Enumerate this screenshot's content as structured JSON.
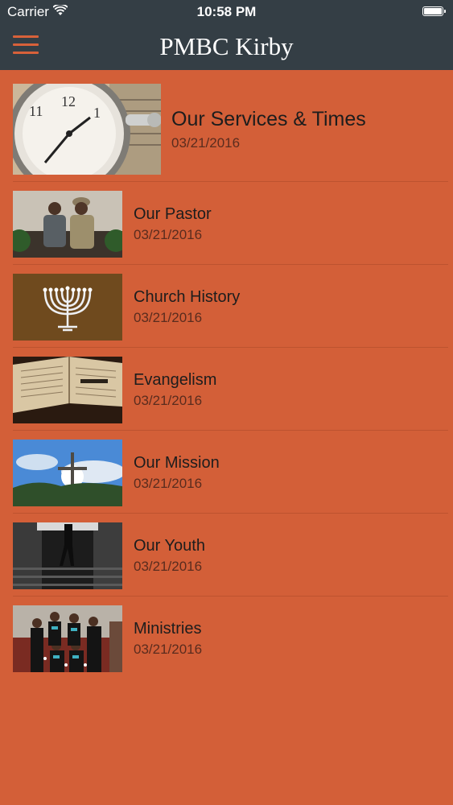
{
  "status_bar": {
    "carrier": "Carrier",
    "time": "10:58 PM"
  },
  "header": {
    "title": "PMBC Kirby",
    "menu_icon": "hamburger-icon"
  },
  "items": [
    {
      "title": "Our Services & Times",
      "date": "03/21/2016",
      "image": "pocket-watch-photo"
    },
    {
      "title": "Our Pastor",
      "date": "03/21/2016",
      "image": "pastor-couple-photo"
    },
    {
      "title": "Church History",
      "date": "03/21/2016",
      "image": "menorah-photo"
    },
    {
      "title": "Evangelism",
      "date": "03/21/2016",
      "image": "open-bible-photo"
    },
    {
      "title": "Our Mission",
      "date": "03/21/2016",
      "image": "cross-sky-photo"
    },
    {
      "title": "Our Youth",
      "date": "03/21/2016",
      "image": "youth-stairs-photo"
    },
    {
      "title": "Ministries",
      "date": "03/21/2016",
      "image": "ministry-group-photo"
    }
  ],
  "colors": {
    "background": "#d35f38",
    "header": "#343e45",
    "accent": "#d8613a"
  }
}
